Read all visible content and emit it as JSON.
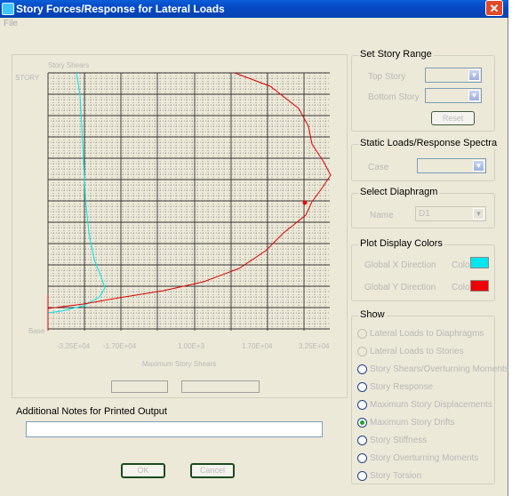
{
  "window": {
    "title": "Story Forces/Response for Lateral Loads",
    "close_glyph": "✕",
    "menu_item": "File"
  },
  "plot": {
    "top_tag": "Story Shears",
    "y_top_label": "STORY",
    "y_bottom_label": "Base",
    "x_ticks": [
      "-3.25E+04",
      "-1.70E+04",
      "1.00E+3",
      "1.70E+04",
      "3.25E+04"
    ],
    "x_axis_title": "Maximum Story Shears",
    "series_colors": {
      "first": "#00e5ee",
      "second": "#dd0000"
    }
  },
  "notes": {
    "label": "Additional Notes for Printed Output",
    "value": ""
  },
  "buttons": {
    "ok": "OK",
    "cancel": "Cancel"
  },
  "set_story_range": {
    "title": "Set Story Range",
    "top_story_label": "Top Story",
    "top_story_value": "",
    "bottom_story_label": "Bottom Story",
    "bottom_story_value": "",
    "reset_button": "Reset"
  },
  "static_loads": {
    "title": "Static Loads/Response Spectra",
    "case_label": "Case",
    "case_value": ""
  },
  "diaphragm": {
    "title": "Select  Diaphragm",
    "name_label": "Name",
    "name_value": "D1"
  },
  "colors": {
    "title": "Plot Display Colors",
    "row1_label": "Global X Direction",
    "row1_tag": "Color",
    "row1_color": "#00e5ee",
    "row2_label": "Global Y Direction",
    "row2_tag": "Color",
    "row2_color": "#ee0000"
  },
  "show": {
    "title": "Show",
    "options": [
      "Lateral Loads to Diaphragms",
      "Lateral Loads to Stories",
      "Story Shears/Overturning Moments",
      "Story Response",
      "Maximum Story Displacements",
      "Maximum Story Drifts",
      "Story Stiffness",
      "Story Overturning Moments",
      "Story Torsion"
    ],
    "selected_index": 5
  }
}
